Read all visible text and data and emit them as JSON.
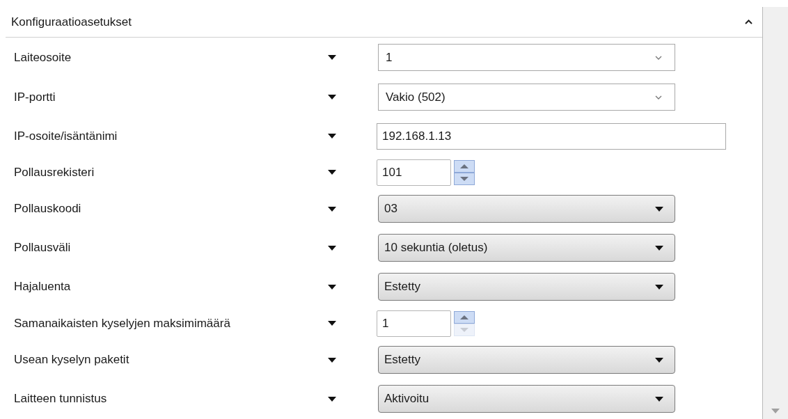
{
  "section": {
    "title": "Konfiguraatioasetukset",
    "expanded": true
  },
  "rows": [
    {
      "label": "Laiteosoite",
      "kind": "combo",
      "value": "1"
    },
    {
      "label": "IP-portti",
      "kind": "combo",
      "value": "Vakio (502)"
    },
    {
      "label": "IP-osoite/isäntänimi",
      "kind": "text",
      "value": "192.168.1.13"
    },
    {
      "label": "Pollausrekisteri",
      "kind": "spin",
      "value": "101",
      "down_disabled": false
    },
    {
      "label": "Pollauskoodi",
      "kind": "dropdown",
      "value": "03"
    },
    {
      "label": "Pollausväli",
      "kind": "dropdown",
      "value": "10 sekuntia (oletus)"
    },
    {
      "label": "Hajaluenta",
      "kind": "dropdown",
      "value": "Estetty"
    },
    {
      "label": "Samanaikaisten kyselyjen maksimimäärä",
      "kind": "spin",
      "value": "1",
      "down_disabled": true
    },
    {
      "label": "Usean kyselyn paketit",
      "kind": "dropdown",
      "value": "Estetty"
    },
    {
      "label": "Laitteen tunnistus",
      "kind": "dropdown",
      "value": "Aktivoitu"
    }
  ]
}
